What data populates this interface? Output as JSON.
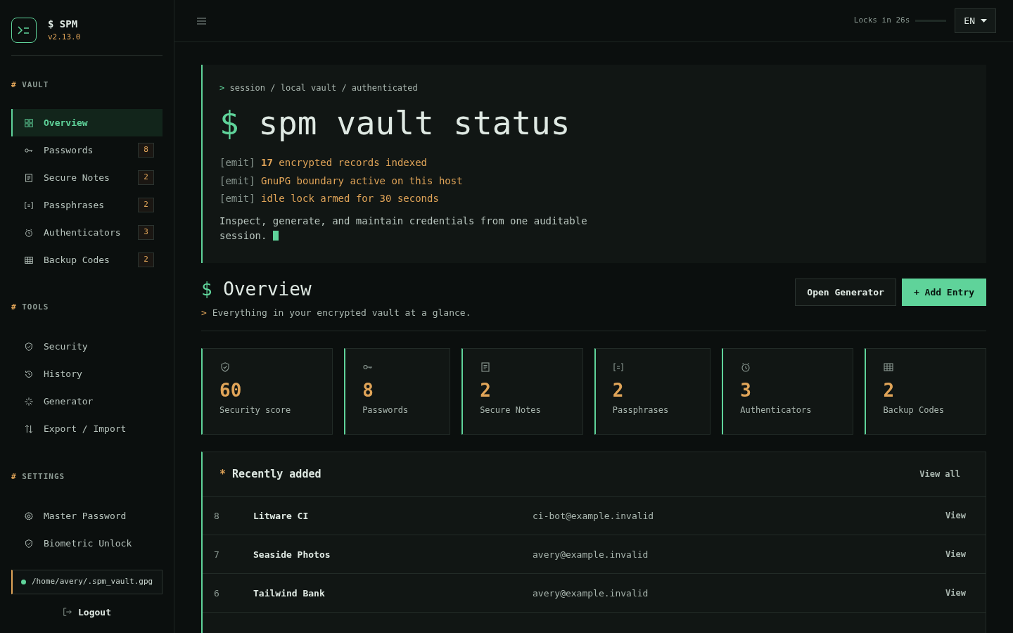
{
  "brand": {
    "title": "$ SPM",
    "version": "v2.13.0"
  },
  "sidebar": {
    "sections": [
      {
        "prefix": "#",
        "heading": "VAULT",
        "items": [
          {
            "label": "Overview",
            "kind": "grid",
            "selected": true
          },
          {
            "label": "Passwords",
            "kind": "key",
            "badge": "8",
            "selected": false
          },
          {
            "label": "Secure Notes",
            "kind": "note",
            "badge": "2",
            "selected": false
          },
          {
            "label": "Passphrases",
            "kind": "phrase",
            "badge": "2",
            "selected": false
          },
          {
            "label": "Authenticators",
            "kind": "clock",
            "badge": "3",
            "selected": false
          },
          {
            "label": "Backup Codes",
            "kind": "table",
            "badge": "2",
            "selected": false
          }
        ]
      },
      {
        "prefix": "#",
        "heading": "TOOLS",
        "items": [
          {
            "label": "Security",
            "kind": "shield",
            "selected": false
          },
          {
            "label": "History",
            "kind": "history",
            "selected": false
          },
          {
            "label": "Generator",
            "kind": "spark",
            "selected": false
          },
          {
            "label": "Export / Import",
            "kind": "arrows",
            "selected": false
          }
        ]
      },
      {
        "prefix": "#",
        "heading": "SETTINGS",
        "items": [
          {
            "label": "Master Password",
            "kind": "gear",
            "selected": false
          },
          {
            "label": "Biometric Unlock",
            "kind": "shield",
            "selected": false
          }
        ]
      }
    ],
    "vault_path": "/home/avery/.spm_vault.gpg",
    "logout": "Logout"
  },
  "topbar": {
    "lock_text": "Locks in 26s",
    "lock": {
      "level": 0
    },
    "language": "EN"
  },
  "hero": {
    "breadcrumb_prefix": ">",
    "breadcrumb": "session / local vault / authenticated",
    "title_prefix": "$",
    "title": "spm vault status",
    "emits": [
      {
        "tag": "[emit]",
        "text": "**17** encrypted records indexed"
      },
      {
        "tag": "[emit]",
        "text": "GnuPG boundary active on this host"
      },
      {
        "tag": "[emit]",
        "text": "idle lock armed for 30 seconds"
      }
    ],
    "description": "Inspect, generate, and maintain credentials from one auditable session."
  },
  "overview": {
    "title_prefix": "$",
    "title": "Overview",
    "subtitle_prefix": ">",
    "subtitle": "Everything in your encrypted vault at a glance.",
    "buttons": [
      {
        "label": "Open Generator",
        "kind": "secondary"
      },
      {
        "label": "+ Add Entry",
        "kind": "primary"
      }
    ]
  },
  "stats": [
    {
      "value": "60",
      "label": "Security score",
      "kind": "shield"
    },
    {
      "value": "8",
      "label": "Passwords",
      "kind": "key"
    },
    {
      "value": "2",
      "label": "Secure Notes",
      "kind": "note"
    },
    {
      "value": "2",
      "label": "Passphrases",
      "kind": "phrase"
    },
    {
      "value": "3",
      "label": "Authenticators",
      "kind": "clock"
    },
    {
      "value": "2",
      "label": "Backup Codes",
      "kind": "table"
    }
  ],
  "recent": {
    "title_prefix": "*",
    "title": "Recently added",
    "view_all": "View all",
    "rows": [
      {
        "id": "8",
        "name": "Litware CI",
        "user": "ci-bot@example.invalid",
        "action": "View"
      },
      {
        "id": "7",
        "name": "Seaside Photos",
        "user": "avery@example.invalid",
        "action": "View"
      },
      {
        "id": "6",
        "name": "Tailwind Bank",
        "user": "avery@example.invalid",
        "action": "View"
      }
    ]
  }
}
